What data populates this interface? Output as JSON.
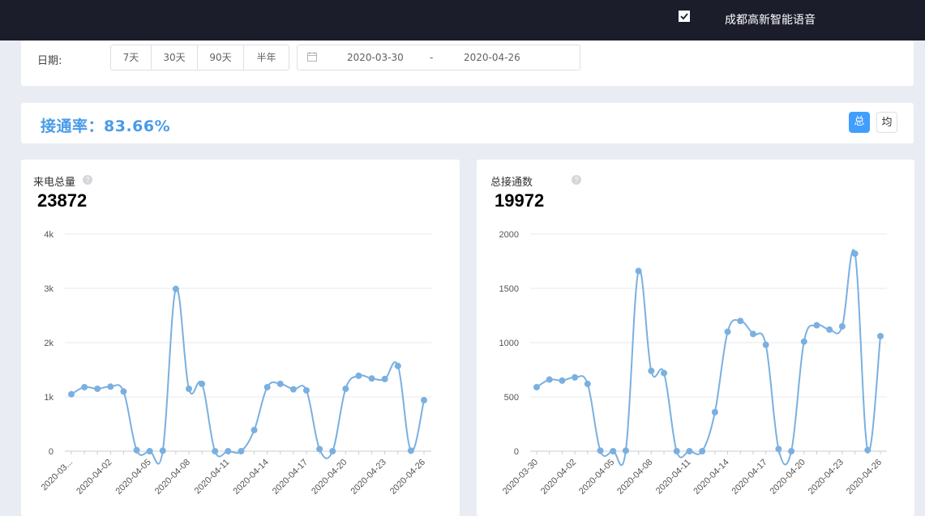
{
  "topbar": {
    "org_name": "成都高新智能语音",
    "calendar_icon": "calendar-check-icon"
  },
  "filter": {
    "date_label": "日期:",
    "ranges": [
      "7天",
      "30天",
      "90天",
      "半年"
    ],
    "start_date": "2020-03-30",
    "separator": "-",
    "end_date": "2020-04-26",
    "date_icon": "calendar-icon"
  },
  "rate": {
    "text": "接通率：83.66%",
    "toggle_total": "总",
    "toggle_avg": "均"
  },
  "colors": {
    "accent": "#409eff",
    "rate_text": "#4a9be8",
    "series": "#7ab0e0",
    "topbar": "#1c1d2b"
  },
  "charts": {
    "left": {
      "title": "来电总量",
      "total": "23872",
      "help_icon": "question-circle-icon"
    },
    "right": {
      "title": "总接通数",
      "total": "19972",
      "help_icon": "question-circle-icon"
    }
  },
  "chart_data": [
    {
      "type": "line",
      "title": "来电总量",
      "ylim": [
        0,
        4000
      ],
      "y_ticks": [
        "0",
        "1k",
        "2k",
        "3k",
        "4k"
      ],
      "x_tick_labels": [
        "2020-03...",
        "2020-04-02",
        "2020-04-05",
        "2020-04-08",
        "2020-04-11",
        "2020-04-14",
        "2020-04-17",
        "2020-04-20",
        "2020-04-23",
        "2020-04-26"
      ],
      "x": [
        "2020-03-30",
        "2020-03-31",
        "2020-04-01",
        "2020-04-02",
        "2020-04-03",
        "2020-04-04",
        "2020-04-05",
        "2020-04-06",
        "2020-04-07",
        "2020-04-08",
        "2020-04-09",
        "2020-04-10",
        "2020-04-11",
        "2020-04-12",
        "2020-04-13",
        "2020-04-14",
        "2020-04-15",
        "2020-04-16",
        "2020-04-17",
        "2020-04-18",
        "2020-04-19",
        "2020-04-20",
        "2020-04-21",
        "2020-04-22",
        "2020-04-23",
        "2020-04-24",
        "2020-04-25",
        "2020-04-26"
      ],
      "values": [
        1050,
        1180,
        1150,
        1190,
        1100,
        20,
        0,
        10,
        2990,
        1150,
        1240,
        0,
        0,
        0,
        390,
        1180,
        1240,
        1140,
        1120,
        40,
        0,
        1150,
        1390,
        1340,
        1330,
        1570,
        10,
        940
      ],
      "grid": true
    },
    {
      "type": "line",
      "title": "总接通数",
      "ylim": [
        0,
        2000
      ],
      "y_ticks": [
        "0",
        "500",
        "1000",
        "1500",
        "2000"
      ],
      "x_tick_labels": [
        "2020-03-30",
        "2020-04-02",
        "2020-04-05",
        "2020-04-08",
        "2020-04-11",
        "2020-04-14",
        "2020-04-17",
        "2020-04-20",
        "2020-04-23",
        "2020-04-26"
      ],
      "x": [
        "2020-03-30",
        "2020-03-31",
        "2020-04-01",
        "2020-04-02",
        "2020-04-03",
        "2020-04-04",
        "2020-04-05",
        "2020-04-06",
        "2020-04-07",
        "2020-04-08",
        "2020-04-09",
        "2020-04-10",
        "2020-04-11",
        "2020-04-12",
        "2020-04-13",
        "2020-04-14",
        "2020-04-15",
        "2020-04-16",
        "2020-04-17",
        "2020-04-18",
        "2020-04-19",
        "2020-04-20",
        "2020-04-21",
        "2020-04-22",
        "2020-04-23",
        "2020-04-24",
        "2020-04-25",
        "2020-04-26"
      ],
      "values": [
        590,
        660,
        650,
        680,
        620,
        5,
        0,
        5,
        1660,
        740,
        720,
        0,
        0,
        0,
        360,
        1100,
        1200,
        1080,
        980,
        20,
        0,
        1010,
        1160,
        1120,
        1150,
        1820,
        10,
        1060
      ],
      "grid": true
    }
  ]
}
